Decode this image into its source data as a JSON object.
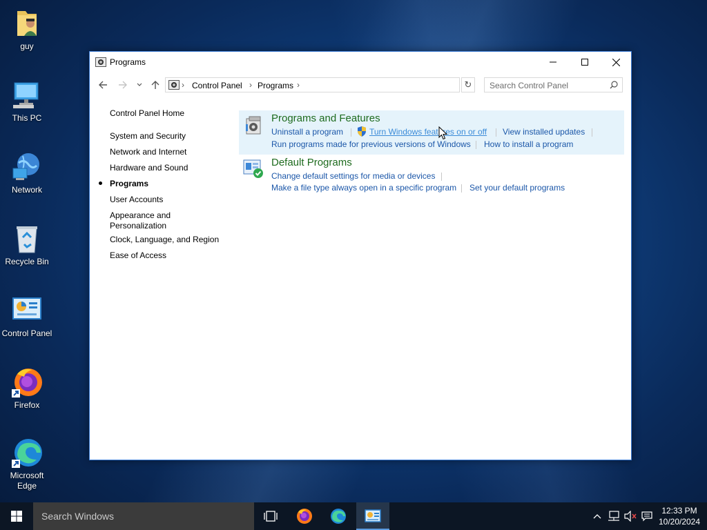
{
  "desktop": {
    "icons": [
      {
        "label": "guy"
      },
      {
        "label": "This PC"
      },
      {
        "label": "Network"
      },
      {
        "label": "Recycle Bin"
      },
      {
        "label": "Control Panel"
      },
      {
        "label": "Firefox"
      },
      {
        "label": "Microsoft Edge"
      }
    ]
  },
  "window": {
    "title": "Programs",
    "breadcrumb": [
      "Control Panel",
      "Programs"
    ],
    "search_placeholder": "Search Control Panel",
    "left_nav": {
      "home": "Control Panel Home",
      "items": [
        "System and Security",
        "Network and Internet",
        "Hardware and Sound",
        "Programs",
        "User Accounts",
        "Appearance and Personalization",
        "Clock, Language, and Region",
        "Ease of Access"
      ],
      "current": "Programs"
    },
    "categories": [
      {
        "title": "Programs and Features",
        "links": [
          "Uninstall a program",
          "Turn Windows features on or off",
          "View installed updates",
          "Run programs made for previous versions of Windows",
          "How to install a program"
        ]
      },
      {
        "title": "Default Programs",
        "links": [
          "Change default settings for media or devices",
          "Make a file type always open in a specific program",
          "Set your default programs"
        ]
      }
    ]
  },
  "taskbar": {
    "search_placeholder": "Search Windows",
    "time": "12:33 PM",
    "date": "10/20/2024"
  },
  "colors": {
    "link": "#1a56a8",
    "category_title": "#1e6b1e",
    "highlight": "#e5f3fb",
    "taskbar": "#0c1624"
  }
}
